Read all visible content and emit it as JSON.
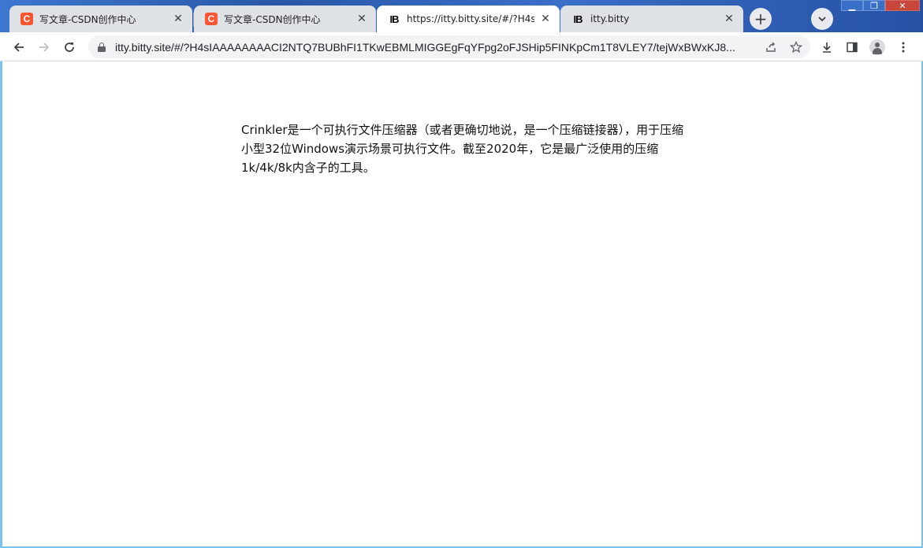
{
  "tabs": [
    {
      "title": "写文章-CSDN创作中心",
      "favicon": "csdn-icon",
      "active": false
    },
    {
      "title": "写文章-CSDN创作中心",
      "favicon": "csdn-icon",
      "active": false
    },
    {
      "title": "https://itty.bitty.site/#/?H4sIA",
      "favicon": "ib-icon",
      "active": true
    },
    {
      "title": "itty.bitty",
      "favicon": "ib-icon",
      "active": false
    }
  ],
  "favicons": {
    "csdn_letter": "C",
    "ib_letters": "IB"
  },
  "tab_close_glyph": "✕",
  "new_tab_glyph": "+",
  "omnibox": {
    "url": "itty.bitty.site/#/?H4sIAAAAAAAACI2NTQ7BUBhFI1TKwEBMLMIGGEgFqYFpg2oFJSHip5FINKpCm1T8VLEY7/tejWxBWxKJ8..."
  },
  "window_controls": {
    "minimize": "▁",
    "maximize": "❐",
    "close": "✕"
  },
  "page": {
    "text": "Crinkler是一个可执行文件压缩器（或者更确切地说，是一个压缩链接器），用于压缩小型32位Windows演示场景可执行文件。截至2020年，它是最广泛使用的压缩1k/4k/8k内含子的工具。"
  },
  "colors": {
    "csdn_brand": "#fc5531",
    "tab_active": "#ffffff",
    "tab_inactive": "#dee1e6",
    "title_bar": "#2857a8"
  }
}
